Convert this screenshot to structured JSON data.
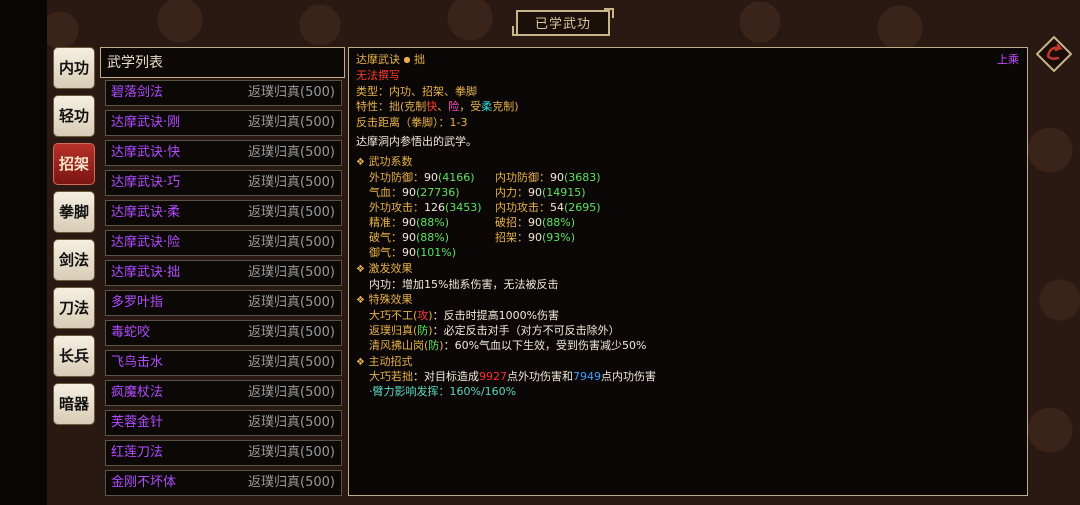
{
  "title": "已学武功",
  "tabs": [
    "内功",
    "轻功",
    "招架",
    "拳脚",
    "剑法",
    "刀法",
    "长兵",
    "暗器"
  ],
  "active_tab": "招架",
  "list": {
    "header": "武学列表",
    "items": [
      {
        "name": "碧落剑法",
        "status": "返璞归真(500)"
      },
      {
        "name": "达摩武诀·刚",
        "status": "返璞归真(500)"
      },
      {
        "name": "达摩武诀·快",
        "status": "返璞归真(500)"
      },
      {
        "name": "达摩武诀·巧",
        "status": "返璞归真(500)"
      },
      {
        "name": "达摩武诀·柔",
        "status": "返璞归真(500)"
      },
      {
        "name": "达摩武诀·险",
        "status": "返璞归真(500)"
      },
      {
        "name": "达摩武诀·拙",
        "status": "返璞归真(500)"
      },
      {
        "name": "多罗叶指",
        "status": "返璞归真(500)"
      },
      {
        "name": "毒蛇咬",
        "status": "返璞归真(500)"
      },
      {
        "name": "飞鸟击水",
        "status": "返璞归真(500)"
      },
      {
        "name": "疯魔杖法",
        "status": "返璞归真(500)"
      },
      {
        "name": "芙蓉金针",
        "status": "返璞归真(500)"
      },
      {
        "name": "红莲刀法",
        "status": "返璞归真(500)"
      },
      {
        "name": "金刚不坏体",
        "status": "返璞归真(500)"
      }
    ]
  },
  "detail": {
    "skill_name": "达摩武诀",
    "skill_variant": "拙",
    "equip_label": "上乘",
    "cannot_write": "无法撰写",
    "type_line": "类型：内功、招架、拳脚",
    "trait_prefix": "特性：拙(克制",
    "trait_fast": "快",
    "trait_sep": "、",
    "trait_risk": "险",
    "trait_mid": "，受",
    "trait_soft": "柔",
    "trait_suffix": "克制)",
    "range_line": "反击距离（拳脚）：1-3",
    "description": "达摩洞内参悟出的武学。",
    "coef_header": "武功系数",
    "stats": [
      {
        "label": "外功防御：",
        "value": "90",
        "extra": "(4166)"
      },
      {
        "label": "内功防御：",
        "value": "90",
        "extra": "(3683)"
      },
      {
        "label": "气血：",
        "value": "90",
        "extra": "(27736)"
      },
      {
        "label": "内力：",
        "value": "90",
        "extra": "(14915)"
      },
      {
        "label": "外功攻击：",
        "value": "126",
        "extra": "(3453)"
      },
      {
        "label": "内功攻击：",
        "value": "54",
        "extra": "(2695)"
      },
      {
        "label": "精准：",
        "value": "90",
        "extra": "(88%)"
      },
      {
        "label": "破招：",
        "value": "90",
        "extra": "(88%)"
      },
      {
        "label": "破气：",
        "value": "90",
        "extra": "(88%)"
      },
      {
        "label": "招架：",
        "value": "90",
        "extra": "(93%)"
      },
      {
        "label": "御气：",
        "value": "90",
        "extra": "(101%)"
      }
    ],
    "trigger_header": "激发效果",
    "trigger_line": "内功：增加15%拙系伤害，无法被反击",
    "special_header": "特殊效果",
    "specials": [
      {
        "name": "大巧不工",
        "tag": "攻",
        "text": "：反击时提高1000%伤害"
      },
      {
        "name": "返璞归真",
        "tag": "防",
        "text": "：必定反击对手（对方不可反击除外）"
      },
      {
        "name": "清风拂山岗",
        "tag": "防",
        "text": "：60%气血以下生效，受到伤害减少50%"
      }
    ],
    "active_header": "主动招式",
    "active_name": "大巧若拙",
    "active_text1": "：对目标造成",
    "active_outer": "9927",
    "active_text2": "点外功伤害和",
    "active_inner": "7949",
    "active_text3": "点内功伤害",
    "arm_line": "·臂力影响发挥：160%/160%"
  },
  "colors": {
    "accent_gold": "#e7b24a",
    "skill_purple": "#b04bff",
    "active_tab_red": "#9a1f1a"
  }
}
